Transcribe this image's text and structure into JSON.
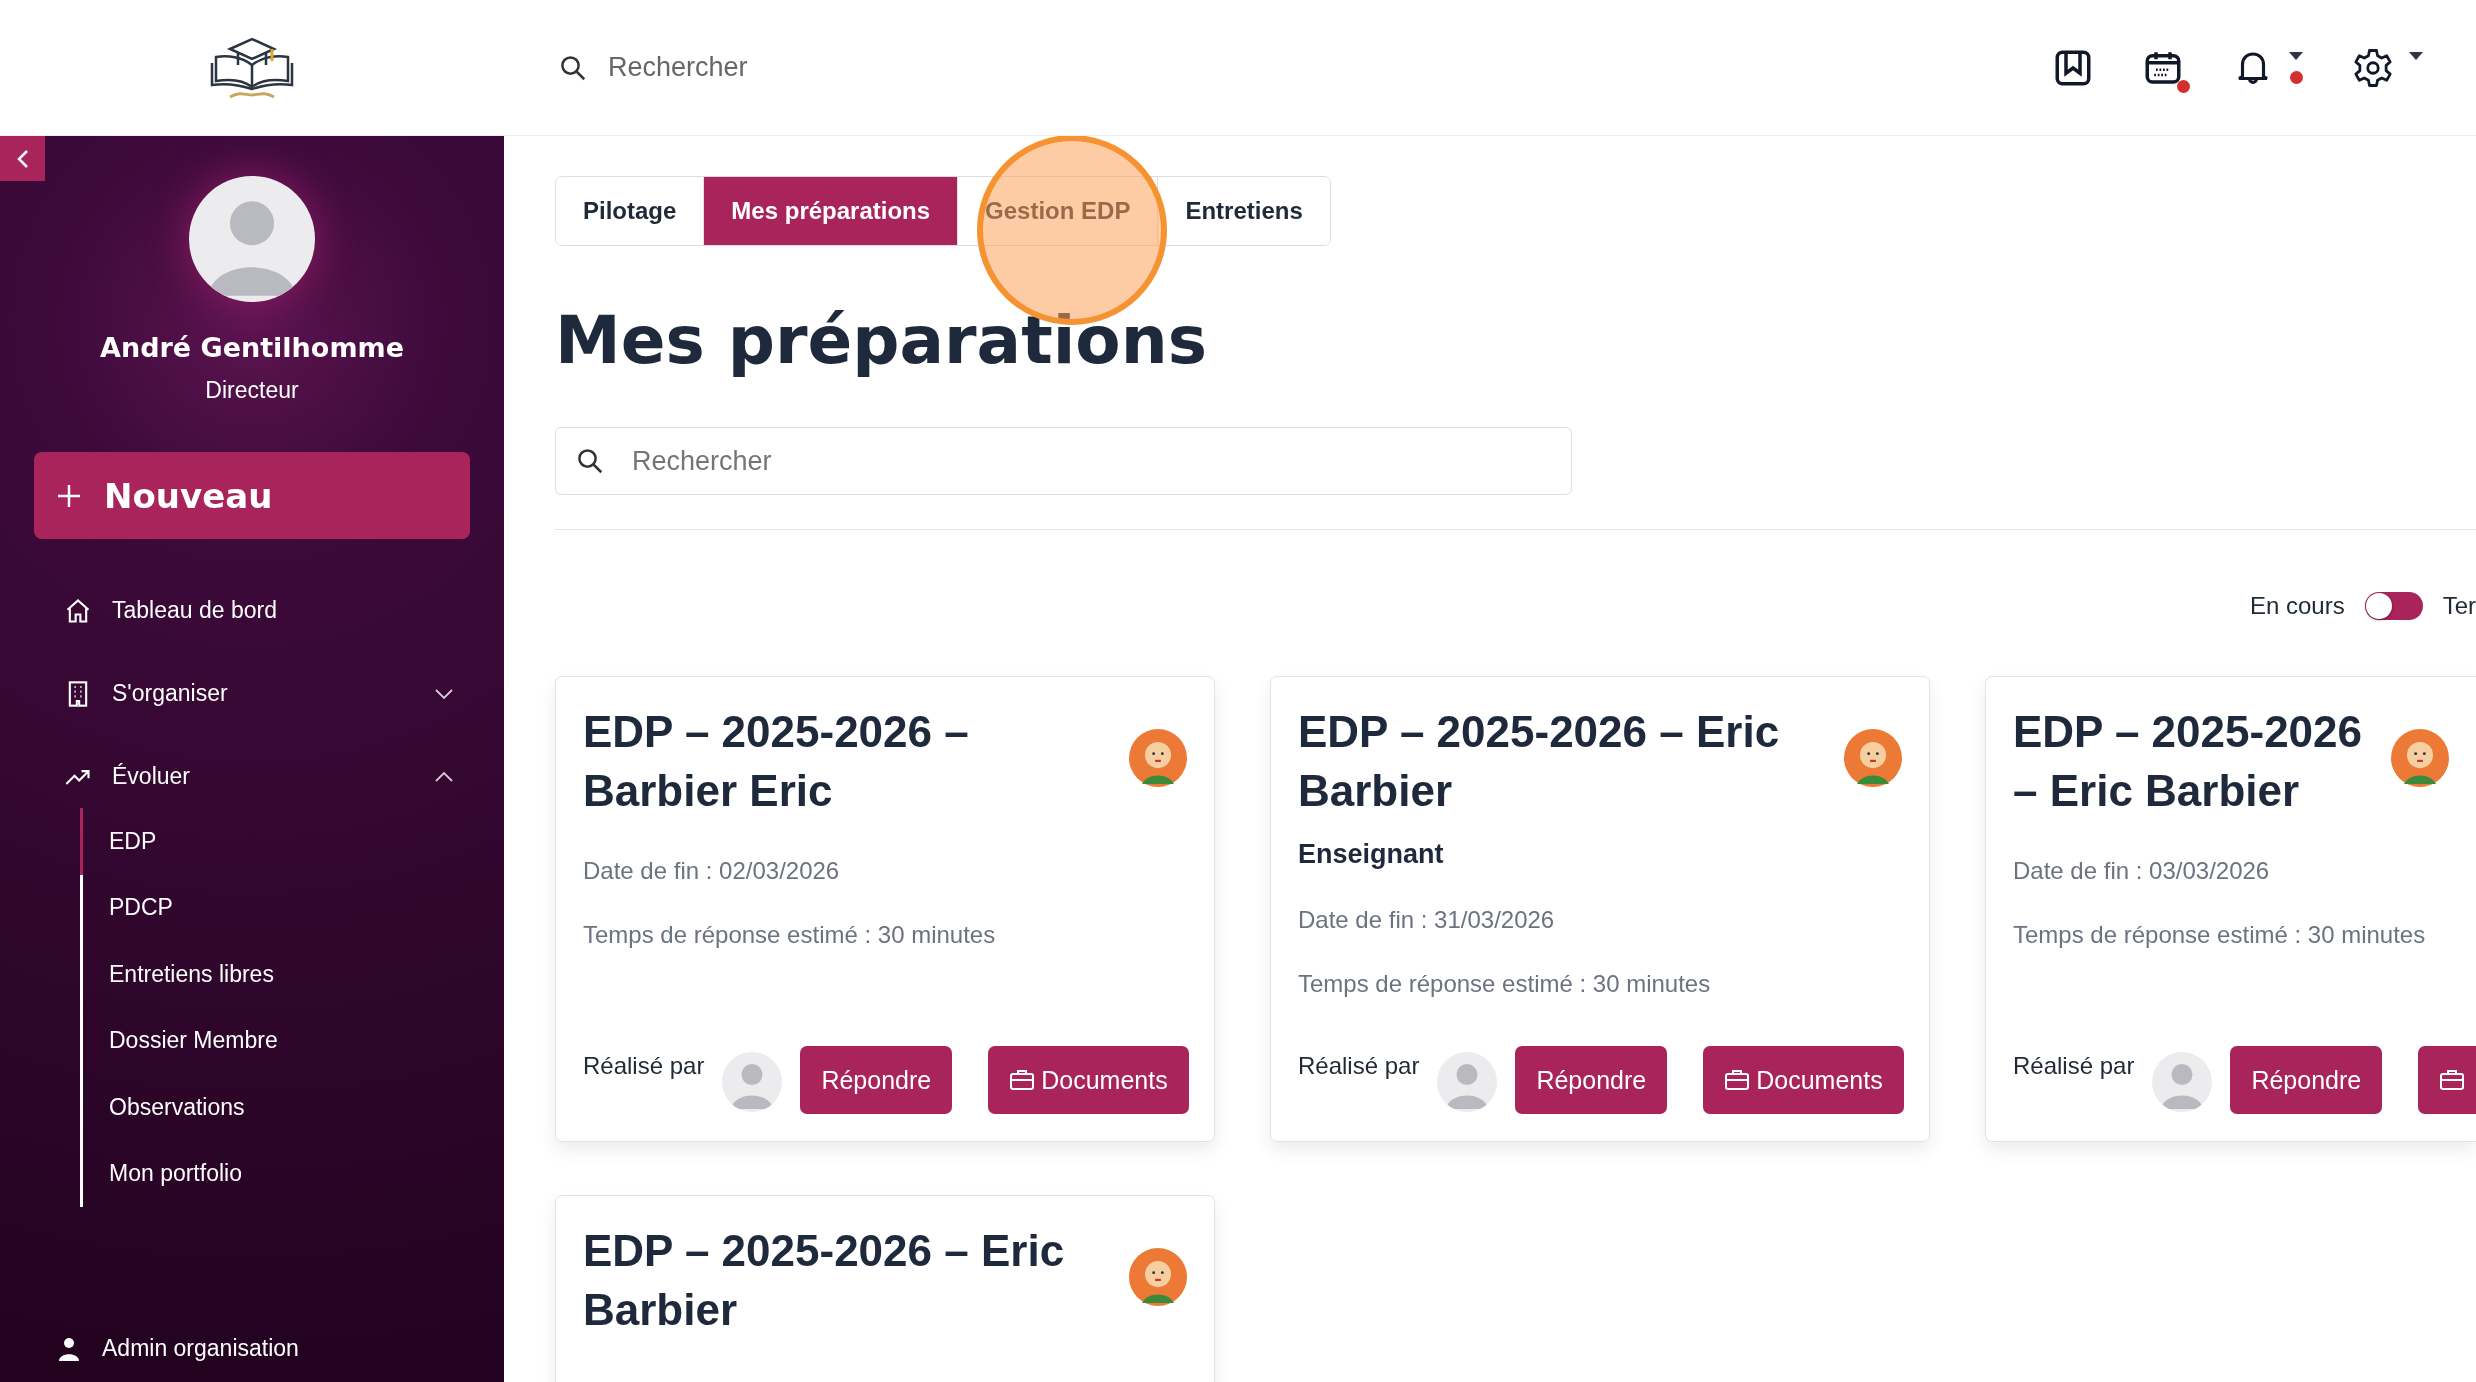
{
  "header": {
    "search": {
      "placeholder": "Rechercher"
    },
    "icons": [
      {
        "kind": "bookmark"
      },
      {
        "kind": "calendar",
        "dot": true
      },
      {
        "kind": "bell",
        "dot": true,
        "caret": true
      },
      {
        "kind": "gear",
        "caret": true
      }
    ]
  },
  "sidebar": {
    "user": {
      "name": "André Gentilhomme",
      "role": "Directeur"
    },
    "new_button": "Nouveau",
    "items": [
      {
        "kind": "home",
        "label": "Tableau de bord"
      },
      {
        "kind": "building",
        "label": "S'organiser",
        "expanded": false
      },
      {
        "kind": "trend",
        "label": "Évoluer",
        "expanded": true,
        "children": [
          {
            "label": "EDP",
            "selected": true
          },
          {
            "label": "PDCP",
            "selected": false
          },
          {
            "label": "Entretiens libres",
            "selected": false
          },
          {
            "label": "Dossier Membre",
            "selected": false
          },
          {
            "label": "Observations",
            "selected": false
          },
          {
            "label": "Mon portfolio",
            "selected": false
          }
        ]
      }
    ],
    "footer": "Admin organisation"
  },
  "tabs": [
    {
      "label": "Pilotage",
      "selected": false
    },
    {
      "label": "Mes préparations",
      "selected": true
    },
    {
      "label": "Gestion EDP",
      "selected": false
    },
    {
      "label": "Entretiens",
      "selected": false
    }
  ],
  "page_title": "Mes préparations",
  "search": {
    "placeholder": "Rechercher"
  },
  "filter": {
    "left": "En cours",
    "on": false,
    "right": "Ter"
  },
  "cards": [
    {
      "title": "EDP – 2025-2026 – Barbier Eric",
      "end_date": "Date de fin : 02/03/2026",
      "duration": "Temps de réponse estimé : 30 minutes",
      "by": "Réalisé par",
      "buttons": [
        {
          "kind": "reply",
          "label": "Répondre"
        },
        {
          "kind": "documents",
          "label": "Documents"
        }
      ]
    },
    {
      "title": "EDP – 2025-2026 – Eric Barbier",
      "subtitle": "Enseignant",
      "end_date": "Date de fin : 31/03/2026",
      "duration": "Temps de réponse estimé : 30 minutes",
      "by": "Réalisé par",
      "buttons": [
        {
          "kind": "reply",
          "label": "Répondre"
        },
        {
          "kind": "documents",
          "label": "Documents"
        }
      ]
    },
    {
      "title": "EDP – 2025-2026 – Eric Barbier",
      "end_date": "Date de fin : 03/03/2026",
      "duration": "Temps de réponse estimé : 30 minutes",
      "by": "Réalisé par",
      "buttons": [
        {
          "kind": "reply",
          "label": "Répondre"
        },
        {
          "kind": "documents"
        }
      ]
    },
    {
      "title": "EDP – 2025-2026 – Eric Barbier"
    }
  ]
}
